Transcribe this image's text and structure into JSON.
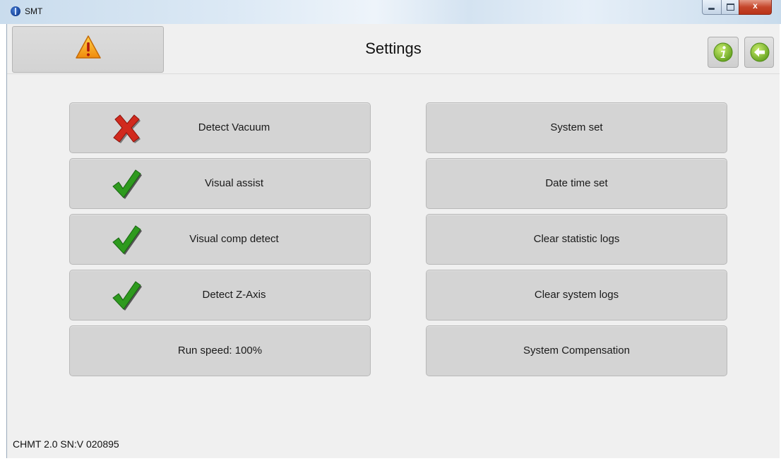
{
  "window": {
    "title": "SMT",
    "minimize_glyph": "",
    "maximize_glyph": "",
    "close_glyph": "x"
  },
  "header": {
    "title": "Settings",
    "warning_icon": "warning-triangle-icon",
    "info_icon": "info-icon",
    "back_icon": "back-arrow-icon"
  },
  "left_buttons": [
    {
      "label": "Detect Vacuum",
      "state_icon": "cross-icon"
    },
    {
      "label": "Visual assist",
      "state_icon": "check-icon"
    },
    {
      "label": "Visual comp detect",
      "state_icon": "check-icon"
    },
    {
      "label": "Detect Z-Axis",
      "state_icon": "check-icon"
    },
    {
      "label": "Run speed:  100%"
    }
  ],
  "right_buttons": [
    {
      "label": "System set"
    },
    {
      "label": "Date time set"
    },
    {
      "label": "Clear statistic logs"
    },
    {
      "label": "Clear system logs"
    },
    {
      "label": "System Compensation"
    }
  ],
  "footer": {
    "version": "CHMT 2.0 SN:V 020895"
  },
  "colors": {
    "check": "#2e9a1e",
    "cross": "#d12a1e",
    "warning": "#f0a51a",
    "info": "#8fc23a",
    "back": "#8fc23a"
  }
}
